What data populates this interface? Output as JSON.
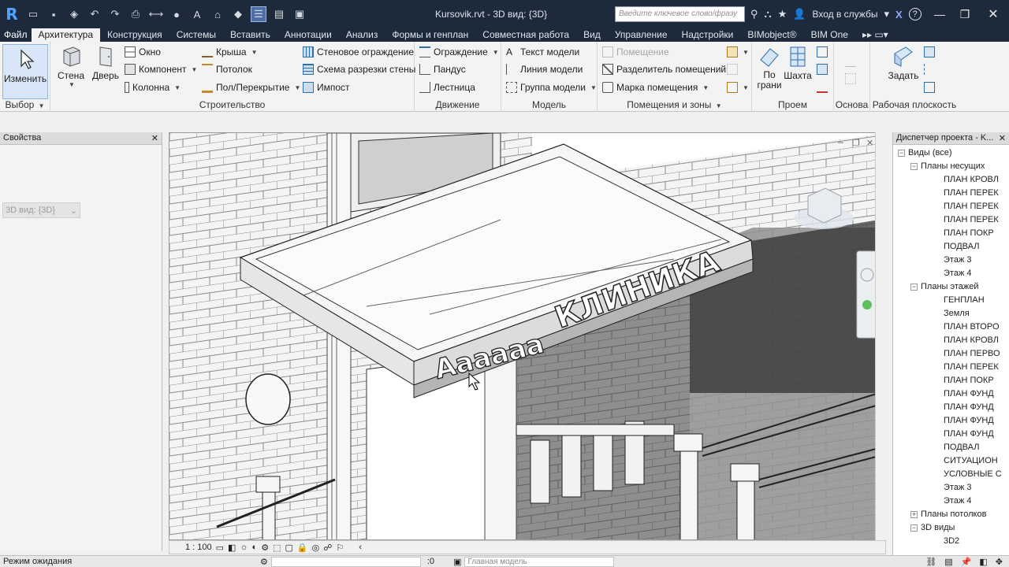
{
  "app": {
    "title": "Kursovik.rvt - 3D вид: {3D}",
    "search_placeholder": "Введите ключевое слово/фразу",
    "login": "Вход в службы",
    "help": "?",
    "exchange": "X"
  },
  "tabs": [
    "Файл",
    "Архитектура",
    "Конструкция",
    "Системы",
    "Вставить",
    "Аннотации",
    "Анализ",
    "Формы и генплан",
    "Совместная работа",
    "Вид",
    "Управление",
    "Надстройки",
    "BIMobject®",
    "BIM One"
  ],
  "active_tab": "Архитектура",
  "ribbon": {
    "select_panel": {
      "modify": "Изменить",
      "label": "Выбор"
    },
    "build_panel": {
      "wall": "Стена",
      "door": "Дверь",
      "window": "Окно",
      "component": "Компонент",
      "column": "Колонна",
      "roof": "Крыша",
      "ceiling": "Потолок",
      "floor": "Пол/Перекрытие",
      "curtain_system": "Стеновое ограждение",
      "curtain_grid": "Схема разрезки стены",
      "mullion": "Импост",
      "label": "Строительство"
    },
    "circulation_panel": {
      "railing": "Ограждение",
      "ramp": "Пандус",
      "stair": "Лестница",
      "label": "Движение"
    },
    "model_panel": {
      "model_text": "Текст модели",
      "model_line": "Линия модели",
      "model_group": "Группа модели",
      "label": "Модель"
    },
    "room_panel": {
      "room": "Помещение",
      "room_separator": "Разделитель помещений",
      "room_tag": "Марка помещения",
      "label": "Помещения и зоны"
    },
    "opening_panel": {
      "by_face": "По\nграни",
      "shaft": "Шахта",
      "label": "Проем"
    },
    "datum_panel": {
      "label": "Основа"
    },
    "workplane_panel": {
      "set": "Задать",
      "label": "Рабочая плоскость"
    }
  },
  "properties": {
    "title": "Свойства",
    "type_selector": "3D вид: {3D}"
  },
  "viewport": {
    "scale": "1 : 100",
    "sign_text": "КЛИНИКА",
    "sign_text2": "Аааааа"
  },
  "browser": {
    "title": "Диспетчер проекта - K...",
    "nodes": [
      {
        "level": 0,
        "toggle": "−",
        "label": "Виды (все)"
      },
      {
        "level": 1,
        "toggle": "−",
        "label": "Планы несущих"
      },
      {
        "level": 2,
        "toggle": "",
        "label": "ПЛАН КРОВЛ"
      },
      {
        "level": 2,
        "toggle": "",
        "label": "ПЛАН ПЕРЕК"
      },
      {
        "level": 2,
        "toggle": "",
        "label": "ПЛАН ПЕРЕК"
      },
      {
        "level": 2,
        "toggle": "",
        "label": "ПЛАН ПЕРЕК"
      },
      {
        "level": 2,
        "toggle": "",
        "label": "ПЛАН ПОКР"
      },
      {
        "level": 2,
        "toggle": "",
        "label": "ПОДВАЛ"
      },
      {
        "level": 2,
        "toggle": "",
        "label": "Этаж 3"
      },
      {
        "level": 2,
        "toggle": "",
        "label": "Этаж 4"
      },
      {
        "level": 1,
        "toggle": "−",
        "label": "Планы этажей"
      },
      {
        "level": 2,
        "toggle": "",
        "label": "ГЕНПЛАН"
      },
      {
        "level": 2,
        "toggle": "",
        "label": "Земля"
      },
      {
        "level": 2,
        "toggle": "",
        "label": "ПЛАН ВТОРО"
      },
      {
        "level": 2,
        "toggle": "",
        "label": "ПЛАН КРОВЛ"
      },
      {
        "level": 2,
        "toggle": "",
        "label": "ПЛАН ПЕРВО"
      },
      {
        "level": 2,
        "toggle": "",
        "label": "ПЛАН ПЕРЕК"
      },
      {
        "level": 2,
        "toggle": "",
        "label": "ПЛАН ПОКР"
      },
      {
        "level": 2,
        "toggle": "",
        "label": "ПЛАН ФУНД"
      },
      {
        "level": 2,
        "toggle": "",
        "label": "ПЛАН ФУНД"
      },
      {
        "level": 2,
        "toggle": "",
        "label": "ПЛАН ФУНД"
      },
      {
        "level": 2,
        "toggle": "",
        "label": "ПЛАН ФУНД"
      },
      {
        "level": 2,
        "toggle": "",
        "label": "ПОДВАЛ"
      },
      {
        "level": 2,
        "toggle": "",
        "label": "СИТУАЦИОН"
      },
      {
        "level": 2,
        "toggle": "",
        "label": "УСЛОВНЫЕ С"
      },
      {
        "level": 2,
        "toggle": "",
        "label": "Этаж 3"
      },
      {
        "level": 2,
        "toggle": "",
        "label": "Этаж 4"
      },
      {
        "level": 1,
        "toggle": "+",
        "label": "Планы потолков"
      },
      {
        "level": 1,
        "toggle": "−",
        "label": "3D виды"
      },
      {
        "level": 2,
        "toggle": "",
        "label": "3D2"
      }
    ]
  },
  "status": {
    "text": "Режим ожидания",
    "zero": ":0",
    "model": "Главная модель"
  }
}
